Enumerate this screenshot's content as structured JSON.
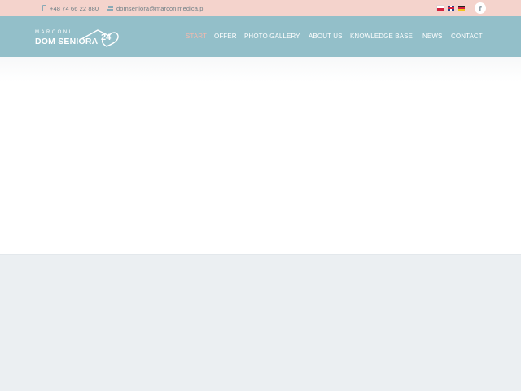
{
  "topbar": {
    "phone": "+48 74 66 22 880",
    "email": "domseniora@marconimedica.pl",
    "languages": [
      "pl",
      "en",
      "de"
    ],
    "social": "f"
  },
  "logo": {
    "brand": "MARCONI",
    "name": "DOM SENIORA",
    "number": "24"
  },
  "nav": {
    "items": [
      "START",
      "OFFER",
      "PHOTO GALLERY",
      "ABOUT US",
      "KNOWLEDGE BASE",
      "NEWS",
      "CONTACT"
    ],
    "active": "START"
  },
  "colors": {
    "topbar": "#f4d3cc",
    "header": "#93bfc9",
    "active_nav": "#f4b9ad",
    "lower_section": "#ebeff2"
  }
}
